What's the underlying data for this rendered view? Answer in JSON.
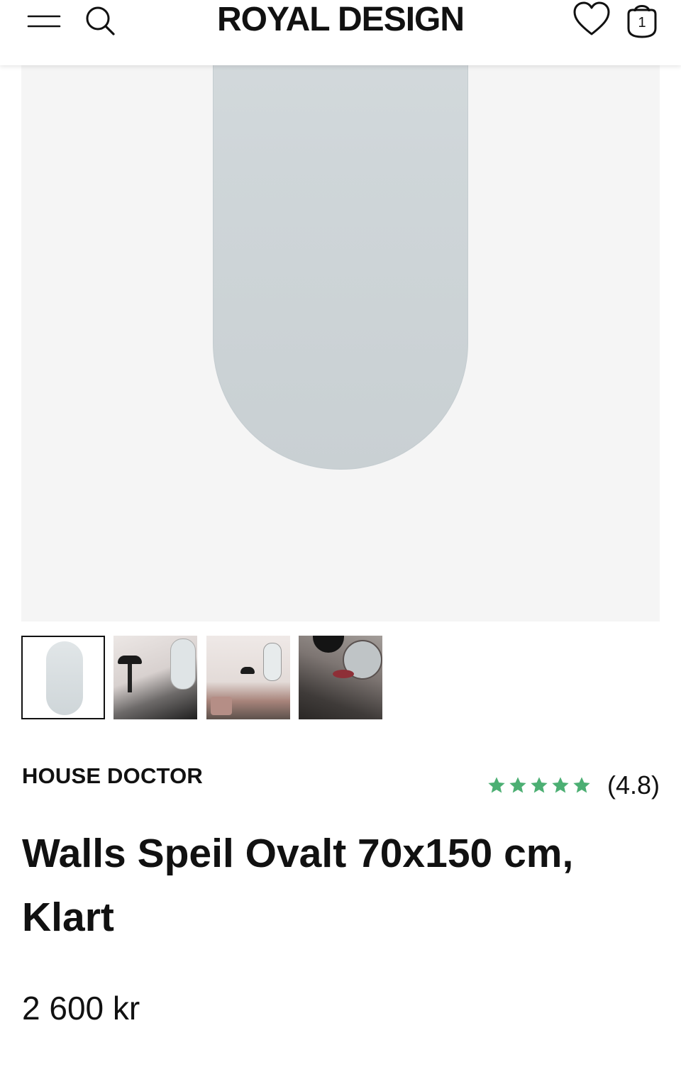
{
  "header": {
    "logo": "ROYAL DESIGN",
    "cart_count": "1",
    "icons": [
      "menu-icon",
      "search-icon",
      "heart-icon",
      "shopping-bag-icon"
    ]
  },
  "product": {
    "brand": "HOUSE DOCTOR",
    "rating_text": "(4.8)",
    "rating_value": 4.8,
    "star_count": 5,
    "star_color": "#4caf73",
    "title": "Walls Speil Ovalt 70x150 cm, Klart",
    "price": "2 600 kr"
  },
  "gallery": {
    "thumbnail_count": 4,
    "selected_index": 0
  }
}
